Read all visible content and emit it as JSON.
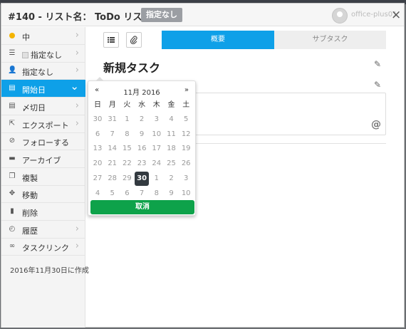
{
  "header": {
    "task_number": "#140 - ",
    "list_prefix": "リスト名：",
    "list_name": "ToDo リスト - ",
    "badge": "指定なし",
    "user": "office-plus01",
    "close": "×"
  },
  "sidebar": {
    "items": [
      {
        "name": "sidebar-item-priority",
        "icon": "dot",
        "label": "中",
        "chevron": true
      },
      {
        "name": "sidebar-item-status",
        "icon": "list-icon",
        "label": "指定なし",
        "chevron": true,
        "checkbox": true
      },
      {
        "name": "sidebar-item-assignee",
        "icon": "user-plus-icon",
        "label": "指定なし",
        "chevron": true
      },
      {
        "name": "sidebar-item-start-date",
        "icon": "calendar-icon",
        "label": "開始日",
        "chevron": true,
        "active": true
      },
      {
        "name": "sidebar-item-due-date",
        "icon": "calendar-icon",
        "label": "〆切日",
        "chevron": true
      },
      {
        "name": "sidebar-item-export",
        "icon": "export-icon",
        "label": "エクスポート",
        "chevron": true
      },
      {
        "name": "sidebar-item-follow",
        "icon": "eye-slash-icon",
        "label": "フォローする",
        "chevron": false
      },
      {
        "name": "sidebar-item-archive",
        "icon": "archive-icon",
        "label": "アーカイブ",
        "chevron": false
      },
      {
        "name": "sidebar-item-duplicate",
        "icon": "copy-icon",
        "label": "複製",
        "chevron": false
      },
      {
        "name": "sidebar-item-move",
        "icon": "move-icon",
        "label": "移動",
        "chevron": false
      },
      {
        "name": "sidebar-item-delete",
        "icon": "trash-icon",
        "label": "削除",
        "chevron": false
      },
      {
        "name": "sidebar-item-history",
        "icon": "history-icon",
        "label": "履歴",
        "chevron": true
      },
      {
        "name": "sidebar-item-tasklink",
        "icon": "link-icon",
        "label": "タスクリンク",
        "chevron": true
      }
    ],
    "created": "2016年11月30日に作成"
  },
  "tabs": [
    {
      "label": "概要",
      "active": true
    },
    {
      "label": "サブタスク",
      "active": false
    }
  ],
  "task": {
    "title": "新規タスク"
  },
  "datepicker": {
    "prev": "«",
    "month_label": "11月 2016",
    "next": "»",
    "weekdays": [
      "日",
      "月",
      "火",
      "水",
      "木",
      "金",
      "土"
    ],
    "weeks": [
      [
        "30",
        "31",
        "1",
        "2",
        "3",
        "4",
        "5"
      ],
      [
        "6",
        "7",
        "8",
        "9",
        "10",
        "11",
        "12"
      ],
      [
        "13",
        "14",
        "15",
        "16",
        "17",
        "18",
        "19"
      ],
      [
        "20",
        "21",
        "22",
        "23",
        "24",
        "25",
        "26"
      ],
      [
        "27",
        "28",
        "29",
        "30",
        "1",
        "2",
        "3"
      ],
      [
        "4",
        "5",
        "6",
        "7",
        "8",
        "9",
        "10"
      ]
    ],
    "selected_week": 4,
    "selected_day": 3,
    "cancel_label": "取消"
  },
  "colors": {
    "accent": "#0ea0e8",
    "cancel": "#0ea24a",
    "selected_day": "#333a40",
    "priority_dot": "#f4b400"
  }
}
